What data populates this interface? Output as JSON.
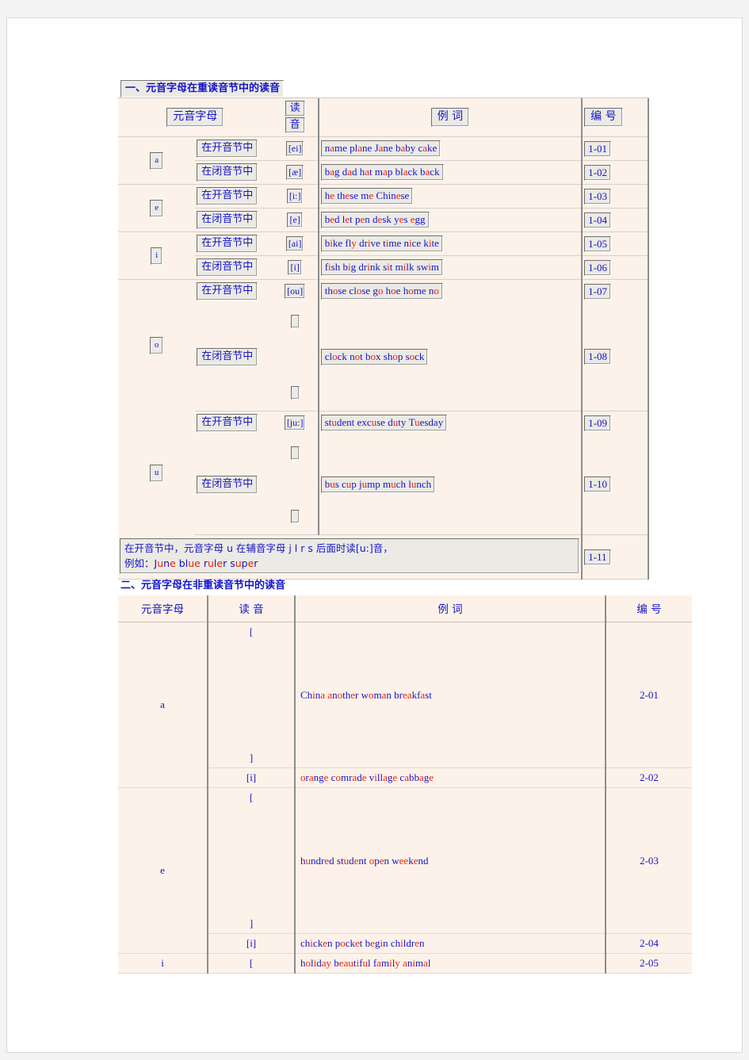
{
  "sections": [
    {
      "heading": "一、元音字母在重读音节中的读音",
      "headers": {
        "letter": "元音字母",
        "ipa_top": "读",
        "ipa_bottom": "音",
        "examples": "例 词",
        "number": "编 号"
      },
      "open_syllable": "在开音节中",
      "closed_syllable": "在闭音节中",
      "groups": [
        {
          "letter": "a",
          "rows": [
            {
              "syllable": "在开音节中",
              "ipa": "[ei]",
              "ipa_broken": false,
              "words": "name plane Jane baby cake",
              "vowels_red": [
                "a",
                "a",
                "a",
                "a",
                "a"
              ],
              "number": "1-01"
            },
            {
              "syllable": "在闭音节中",
              "ipa": "[æ]",
              "ipa_broken": false,
              "words": "bag dad hat map black back",
              "vowels_red": [
                "a",
                "a",
                "a",
                "a",
                "a",
                "a"
              ],
              "number": "1-02"
            }
          ]
        },
        {
          "letter": "e",
          "rows": [
            {
              "syllable": "在开音节中",
              "ipa": "[i:]",
              "ipa_broken": false,
              "words": "he these me Chinese",
              "vowels_red": [
                "e",
                "e",
                "e",
                "e"
              ],
              "number": "1-03"
            },
            {
              "syllable": "在闭音节中",
              "ipa": "[e]",
              "ipa_broken": false,
              "words": "bed let pen desk yes egg",
              "vowels_red": [
                "e",
                "e",
                "e",
                "e",
                "e",
                "e"
              ],
              "number": "1-04"
            }
          ]
        },
        {
          "letter": "i",
          "rows": [
            {
              "syllable": "在开音节中",
              "ipa": "[ai]",
              "ipa_broken": false,
              "words": "bike fly drive time nice kite",
              "vowels_red": [
                "i",
                "y",
                "i",
                "i",
                "i",
                "i"
              ],
              "number": "1-05"
            },
            {
              "syllable": "在闭音节中",
              "ipa": "[i]",
              "ipa_broken": false,
              "words": "fish big drink sit milk swim",
              "vowels_red": [
                "i",
                "i",
                "i",
                "i",
                "i",
                "i"
              ],
              "number": "1-06"
            }
          ]
        },
        {
          "letter": "o",
          "rows": [
            {
              "syllable": "在开音节中",
              "ipa": "[ou]",
              "ipa_broken": false,
              "words": "those close go hoe home no",
              "vowels_red": [
                "o",
                "o",
                "o",
                "o",
                "o",
                "o"
              ],
              "number": "1-07"
            },
            {
              "syllable": "在闭音节中",
              "ipa": "[ ]",
              "ipa_broken": true,
              "words": "clock not box shop sock",
              "vowels_red": [
                "o",
                "o",
                "o",
                "o",
                "o"
              ],
              "number": "1-08"
            }
          ]
        },
        {
          "letter": "u",
          "rows": [
            {
              "syllable": "在开音节中",
              "ipa": "[ju:]",
              "ipa_broken": false,
              "words": "student excuse duty Tuesday",
              "vowels_red": [
                "u",
                "u",
                "u",
                "u"
              ],
              "number": "1-09"
            },
            {
              "syllable": "在闭音节中",
              "ipa": "[ ]",
              "ipa_broken": true,
              "words": "bus cup jump much lunch",
              "vowels_red": [
                "u",
                "u",
                "u",
                "u",
                "u"
              ],
              "number": "1-10"
            }
          ]
        }
      ],
      "note": {
        "line1": "在开音节中，元音字母 u 在辅音字母 j l r s 后面时读[u:]音，",
        "line2_prefix": "例如：",
        "line2_words": "June blue ruler super",
        "number": "1-11"
      }
    },
    {
      "heading": "二、元音字母在非重读音节中的读音",
      "headers": {
        "letter": "元音字母",
        "ipa": "读 音",
        "examples": "例 词",
        "number": "编 号"
      },
      "groups": [
        {
          "letter": "a",
          "rows": [
            {
              "ipa_open": "[",
              "ipa_close": "]",
              "tall": true,
              "words": "China another woman breakfast",
              "number": "2-01"
            },
            {
              "ipa": "[i]",
              "tall": false,
              "words": "orange comrade village cabbage",
              "number": "2-02"
            }
          ]
        },
        {
          "letter": "e",
          "rows": [
            {
              "ipa_open": "[",
              "ipa_close": "]",
              "tall": true,
              "words": "hundred student open weekend",
              "number": "2-03"
            },
            {
              "ipa": "[i]",
              "tall": false,
              "words": "chicken pocket begin children",
              "number": "2-04"
            }
          ]
        },
        {
          "letter": "i",
          "rows": [
            {
              "ipa_open": "[",
              "ipa_close": "",
              "tall": false,
              "words": "holiday beautiful family animal",
              "number": "2-05"
            }
          ]
        }
      ]
    }
  ],
  "colors": {
    "text_blue": "#1414c8",
    "vowel_red": "#ee2200",
    "table_bg": "#fdf2e9",
    "page_bg": "#ffffff",
    "canvas_bg": "#f4f4f4",
    "box_face": "#eceae4"
  }
}
